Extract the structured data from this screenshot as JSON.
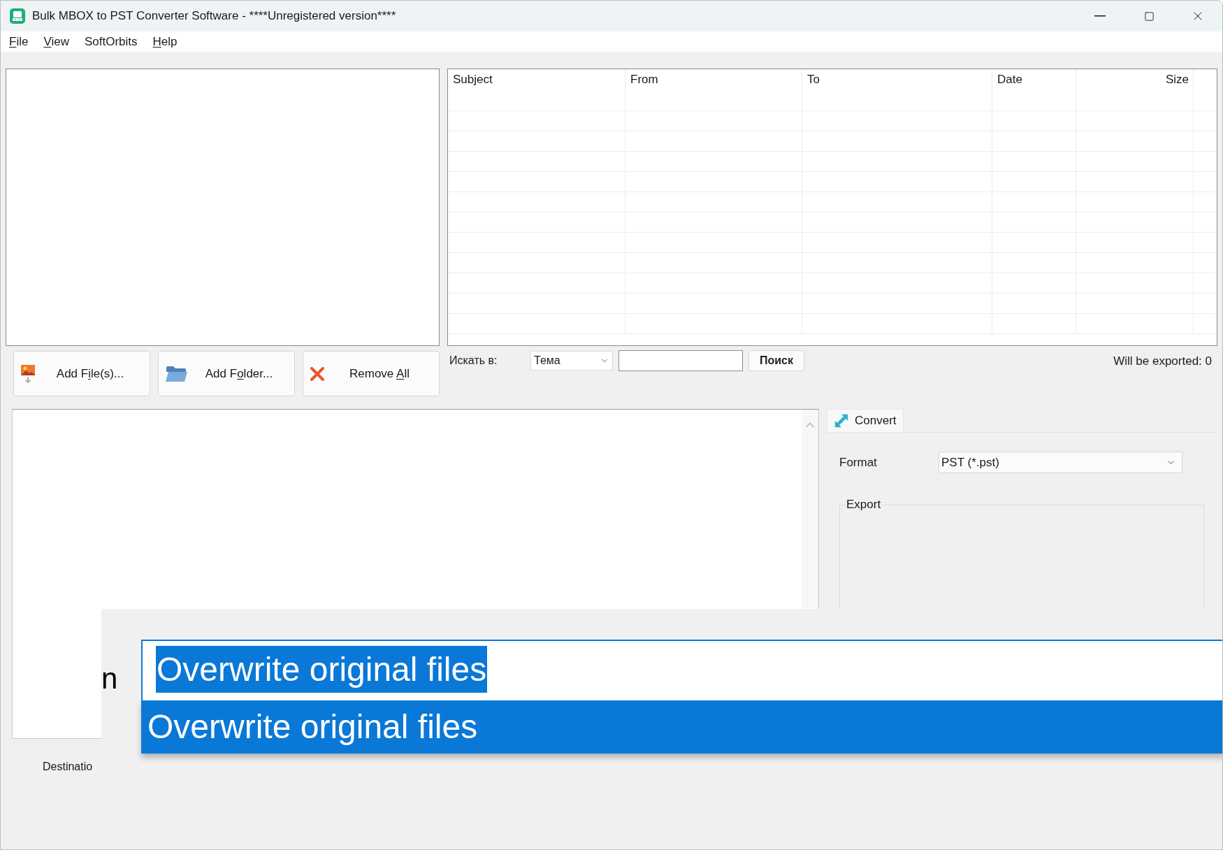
{
  "window": {
    "title": "Bulk MBOX to PST Converter Software - ****Unregistered version****"
  },
  "menu": [
    {
      "label_parts": [
        {
          "text": "F",
          "underlined": true
        },
        {
          "text": "ile",
          "underlined": false
        }
      ]
    },
    {
      "label_parts": [
        {
          "text": "V",
          "underlined": true
        },
        {
          "text": "iew",
          "underlined": false
        }
      ]
    },
    {
      "label_parts": [
        {
          "text": "SoftOrbits",
          "underlined": false
        }
      ]
    },
    {
      "label_parts": [
        {
          "text": "H",
          "underlined": true
        },
        {
          "text": "elp",
          "underlined": false
        }
      ]
    }
  ],
  "message_table": {
    "columns": [
      {
        "label": "Subject"
      },
      {
        "label": "From"
      },
      {
        "label": "To"
      },
      {
        "label": "Date"
      },
      {
        "label": "Size"
      }
    ]
  },
  "toolbar": {
    "buttons": [
      {
        "kind": "add-files",
        "label_parts": [
          {
            "text": "Add F",
            "underlined": false
          },
          {
            "text": "i",
            "underlined": true
          },
          {
            "text": "le(s)...",
            "underlined": false
          }
        ]
      },
      {
        "kind": "add-folder",
        "label_parts": [
          {
            "text": "Add F",
            "underlined": false
          },
          {
            "text": "o",
            "underlined": true
          },
          {
            "text": "lder...",
            "underlined": false
          }
        ]
      },
      {
        "kind": "remove-all",
        "label_parts": [
          {
            "text": "Remove ",
            "underlined": false
          },
          {
            "text": "A",
            "underlined": true
          },
          {
            "text": "ll",
            "underlined": false
          }
        ]
      }
    ]
  },
  "search": {
    "label": "Искать в:",
    "scope": {
      "value": "Тема"
    },
    "button": "Поиск"
  },
  "export_count": "Will be exported: 0",
  "convert_panel": {
    "tabs": [
      {
        "label": "Convert",
        "selected": true
      }
    ],
    "format": {
      "label": "Format",
      "value": "PST (*.pst)"
    },
    "group": {
      "title": "Export"
    }
  },
  "destination_label": "Destinatio",
  "zoom_inset": {
    "label_fragment": "n",
    "combo": {
      "value": "Overwrite original files",
      "text_selected": true
    },
    "options": [
      {
        "label": "Overwrite original files",
        "selected": true
      }
    ]
  }
}
